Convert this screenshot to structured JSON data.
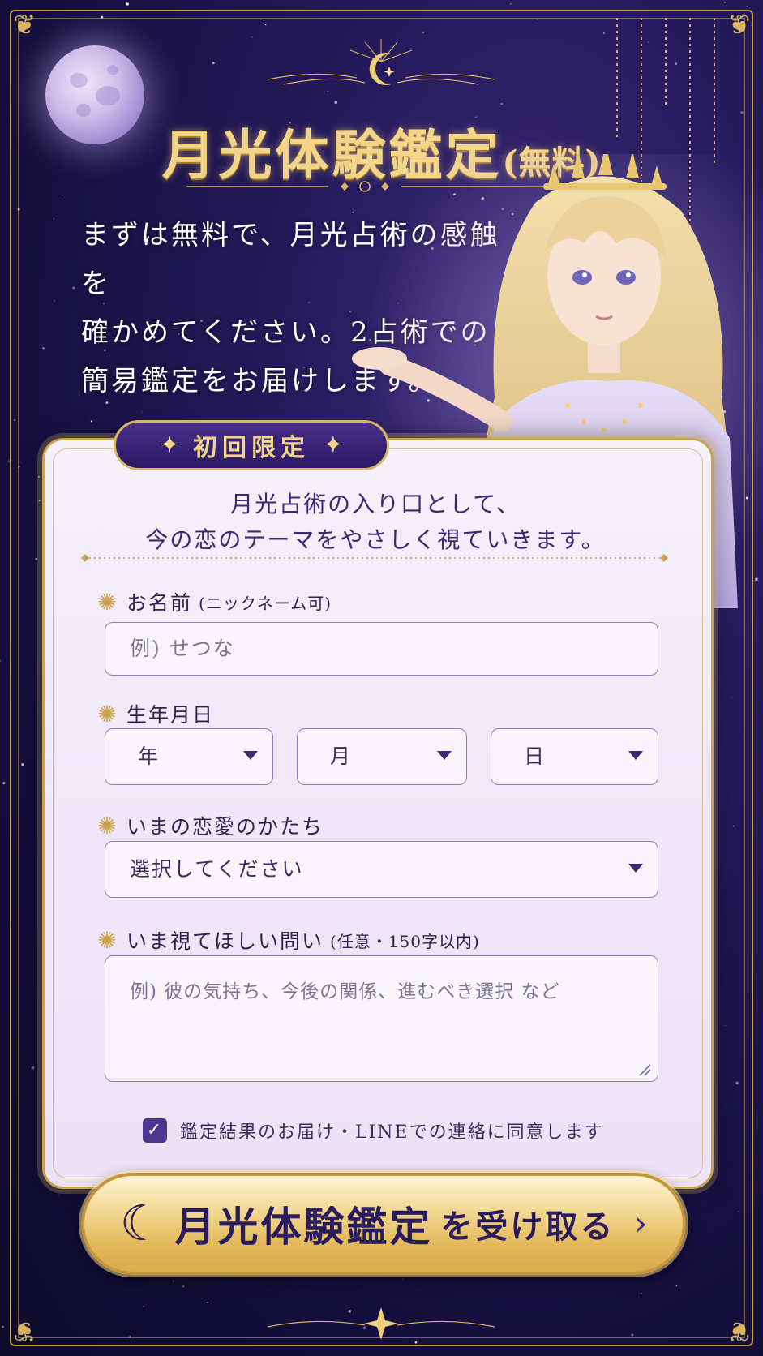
{
  "header": {
    "title_main": "月光体験鑑定",
    "title_suffix": "(無料)",
    "intro_lines": [
      "まずは無料で、月光占術の感触を",
      "確かめてください。2占術での",
      "簡易鑑定をお届けします。"
    ]
  },
  "card": {
    "badge": "初回限定",
    "lead_lines": [
      "月光占術の入り口として、",
      "今の恋のテーマをやさしく視ていきます。"
    ]
  },
  "form": {
    "name": {
      "label": "お名前",
      "note": "(ニックネーム可)",
      "placeholder": "例) せつな"
    },
    "birth": {
      "label": "生年月日",
      "year": "年",
      "month": "月",
      "day": "日"
    },
    "status": {
      "label": "いまの恋愛のかたち",
      "value": "選択してください"
    },
    "question": {
      "label": "いま視てほしい問い",
      "note": "(任意・150字以内)",
      "placeholder": "例) 彼の気持ち、今後の関係、進むべき選択 など"
    },
    "consent": {
      "checked": true,
      "label": "鑑定結果のお届け・LINEでの連絡に同意します"
    }
  },
  "cta": {
    "main": "月光体験鑑定",
    "rest": "を受け取る"
  },
  "icons": {
    "moon": "crescent-moon-icon",
    "sparkle": "sparkle-icon",
    "caret": "caret-down-icon",
    "arrow": "chevron-right-icon"
  },
  "colors": {
    "background": "#1c1450",
    "gold": "#c9a24e",
    "card": "#f3edf9",
    "accent": "#4b3690"
  }
}
